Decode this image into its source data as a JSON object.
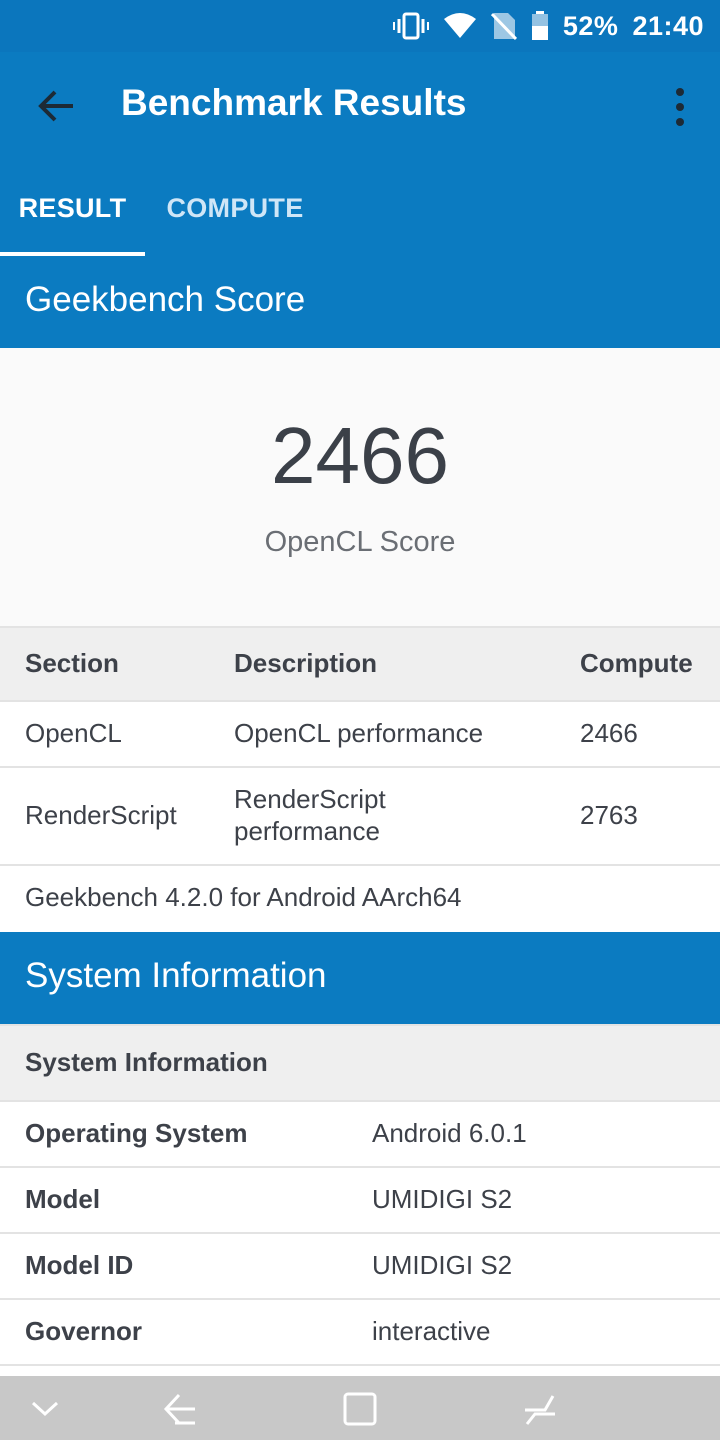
{
  "status_bar": {
    "battery_percent": "52%",
    "time": "21:40",
    "icons": [
      "vibrate-icon",
      "wifi-icon",
      "no-sim-icon",
      "battery-icon"
    ]
  },
  "app_bar": {
    "title": "Benchmark Results",
    "back_icon": "arrow-left-icon",
    "menu_icon": "more-vert-icon"
  },
  "tabs": [
    {
      "label": "RESULT",
      "selected": true
    },
    {
      "label": "COMPUTE",
      "selected": false
    }
  ],
  "geekbench": {
    "section_title": "Geekbench Score",
    "score": "2466",
    "score_label": "OpenCL Score"
  },
  "results_table": {
    "headers": [
      "Section",
      "Description",
      "Compute"
    ],
    "rows": [
      {
        "section": "OpenCL",
        "description": "OpenCL performance",
        "compute": "2466"
      },
      {
        "section": "RenderScript",
        "description_line1": "RenderScript",
        "description_line2": "performance",
        "compute": "2763"
      }
    ],
    "footer": "Geekbench 4.2.0 for Android AArch64"
  },
  "system_info": {
    "section_title": "System Information",
    "table_header": "System Information",
    "rows": [
      {
        "label": "Operating System",
        "value": "Android 6.0.1"
      },
      {
        "label": "Model",
        "value": "UMIDIGI S2"
      },
      {
        "label": "Model ID",
        "value": "UMIDIGI S2"
      },
      {
        "label": "Governor",
        "value": "interactive"
      }
    ]
  },
  "nav_bar": {
    "icons": [
      "chevron-down-icon",
      "back-icon",
      "overview-icon",
      "recents-icon"
    ]
  },
  "colors": {
    "primary": "#0b7bc1",
    "status_bar": "#0b76bd",
    "text_dark": "#3d4149",
    "header_bg": "#efefef",
    "nav_bar": "#c8c8c8"
  }
}
